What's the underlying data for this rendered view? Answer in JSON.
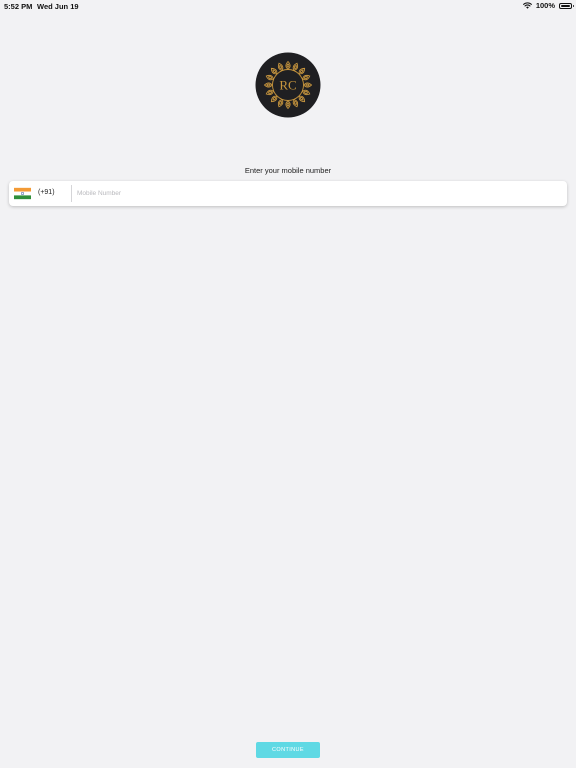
{
  "status_bar": {
    "time": "5:52 PM",
    "date": "Wed Jun 19",
    "battery_percent": "100%",
    "wifi_icon": "wifi-icon",
    "battery_icon": "battery-full-icon"
  },
  "logo": {
    "text": "RC",
    "icon": "rc-monogram-logo",
    "background_color": "#1f1f22",
    "ornament_color": "#c8963e"
  },
  "login": {
    "prompt": "Enter your mobile number",
    "country_flag_icon": "india-flag-icon",
    "country_code": "(+91)",
    "mobile_value": "",
    "mobile_placeholder": "Mobile Number"
  },
  "actions": {
    "continue_label": "CONTINUE",
    "continue_color": "#5fd9e4"
  }
}
